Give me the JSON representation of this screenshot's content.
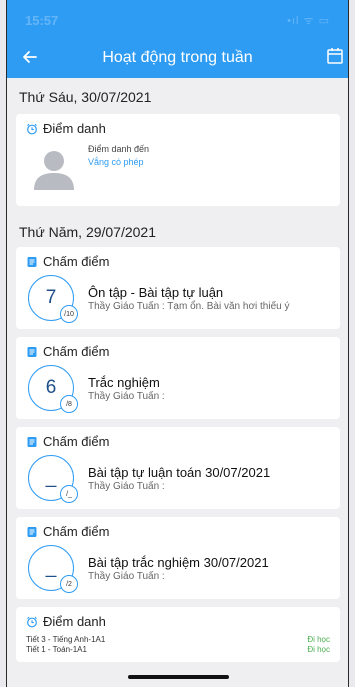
{
  "status": {
    "time": "15:57",
    "sys": "•ıl ᯤ ▭"
  },
  "appbar": {
    "title": "Hoạt động trong tuần"
  },
  "days": [
    {
      "date": "Thứ Sáu, 30/07/2021",
      "attendance": {
        "title": "Điểm danh",
        "line1": "Điểm danh đến",
        "line2": "Vắng có phép"
      }
    },
    {
      "date": "Thứ Năm, 29/07/2021",
      "scores": [
        {
          "title": "Chấm điểm",
          "value": "7",
          "max": "/10",
          "name": "Ôn tập - Bài tập tự luận",
          "comment": "Thầy Giáo Tuấn : Tạm ổn. Bài văn hơi thiếu ý"
        },
        {
          "title": "Chấm điểm",
          "value": "6",
          "max": "/8",
          "name": "Trắc nghiệm",
          "comment": "Thầy Giáo Tuấn :"
        },
        {
          "title": "Chấm điểm",
          "value": "_",
          "max": "/_",
          "name": "Bài tập tự luận toán 30/07/2021",
          "comment": "Thầy Giáo Tuấn :"
        },
        {
          "title": "Chấm điểm",
          "value": "_",
          "max": "/2",
          "name": "Bài tập trắc nghiệm 30/07/2021",
          "comment": "Thầy Giáo Tuấn :"
        }
      ],
      "attendance": {
        "title": "Điểm danh",
        "rows": [
          {
            "lesson": "Tiết 3 - Tiếng Anh-1A1",
            "status": "Đi học"
          },
          {
            "lesson": "Tiết 1 - Toán-1A1",
            "status": "Đi học"
          }
        ]
      }
    }
  ],
  "colors": {
    "accent": "#2f9cf4",
    "present": "#4caf50"
  }
}
